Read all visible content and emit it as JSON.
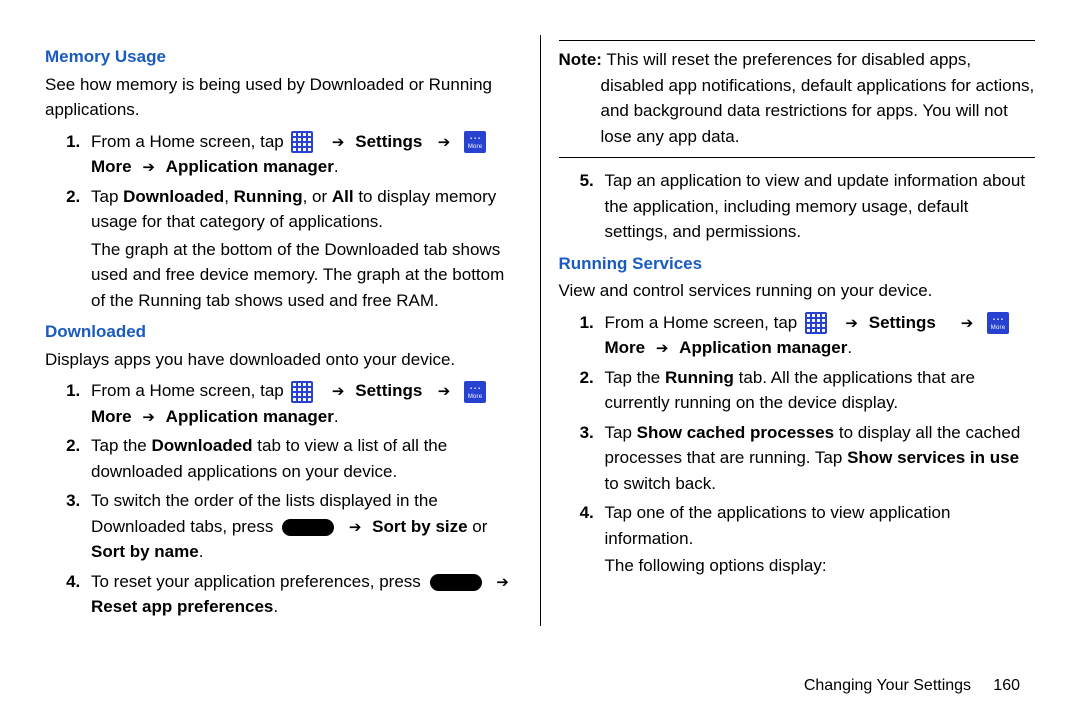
{
  "left": {
    "memory_heading": "Memory Usage",
    "memory_intro": "See how memory is being used by Downloaded or Running applications.",
    "step1_a": "From a Home screen, tap ",
    "settings": "Settings",
    "more": "More",
    "appmgr": "Application manager",
    "mem_step2_a": "Tap ",
    "mem_step2_b": "Downloaded",
    "mem_step2_c": ", ",
    "mem_step2_d": "Running",
    "mem_step2_e": ", or ",
    "mem_step2_f": "All",
    "mem_step2_g": " to display memory usage for that category of applications.",
    "mem_step2_para": "The graph at the bottom of the Downloaded tab shows used and free device memory. The graph at the bottom of the Running tab shows used and free RAM.",
    "downloaded_heading": "Downloaded",
    "downloaded_intro": "Displays apps you have downloaded onto your device.",
    "dl_step2_a": "Tap the ",
    "dl_step2_b": "Downloaded",
    "dl_step2_c": " tab to view a list of all the downloaded applications on your device.",
    "dl_step3_a": "To switch the order of the lists displayed in the Downloaded tabs, press ",
    "dl_step3_sortsize": "Sort by size",
    "dl_step3_or": " or ",
    "dl_step3_sortname": "Sort by name",
    "dl_step4_a": "To reset your application preferences, press ",
    "dl_step4_reset": "Reset app preferences"
  },
  "right": {
    "note_label": "Note:",
    "note_text": " This will reset the preferences for disabled apps, disabled app notifications, default applications for actions, and background data restrictions for apps. You will not lose any app data.",
    "step5": "Tap an application to view and update information about the application, including memory usage, default settings, and permissions.",
    "running_heading": "Running Services",
    "running_intro": "View and control services running on your device.",
    "run_step2_a": "Tap the ",
    "run_step2_b": "Running",
    "run_step2_c": " tab. All the applications that are currently running on the device display.",
    "run_step3_a": "Tap ",
    "run_step3_b": "Show cached processes",
    "run_step3_c": " to display all the cached processes that are running. Tap ",
    "run_step3_d": "Show services in use",
    "run_step3_e": " to switch back.",
    "run_step4": "Tap one of the applications to view application information.",
    "run_step4_para": "The following options display:"
  },
  "icons": {
    "apps": "apps-icon",
    "more": "more-icon",
    "menu": "menu-key"
  },
  "footer": {
    "section": "Changing Your Settings",
    "page": "160"
  }
}
